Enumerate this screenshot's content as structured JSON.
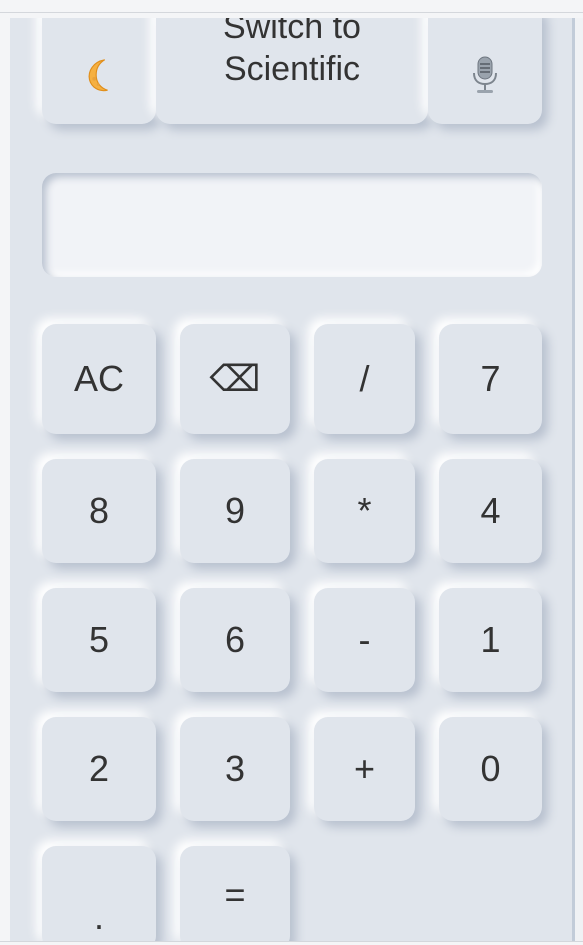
{
  "header": {
    "mode_toggle_label": "Switch to\nScientific",
    "theme_icon": "crescent-moon-icon",
    "voice_icon": "microphone-icon"
  },
  "display": {
    "value": ""
  },
  "keypad": {
    "keys": [
      "AC",
      "⌫",
      "/",
      "7",
      "8",
      "9",
      "*",
      "4",
      "5",
      "6",
      "-",
      "1",
      "2",
      "3",
      "+",
      "0",
      ".",
      "="
    ]
  },
  "colors": {
    "panel_bg": "#e0e5ec",
    "page_bg": "#f4f5f7",
    "text": "#333333",
    "moon": "#f5b041"
  }
}
